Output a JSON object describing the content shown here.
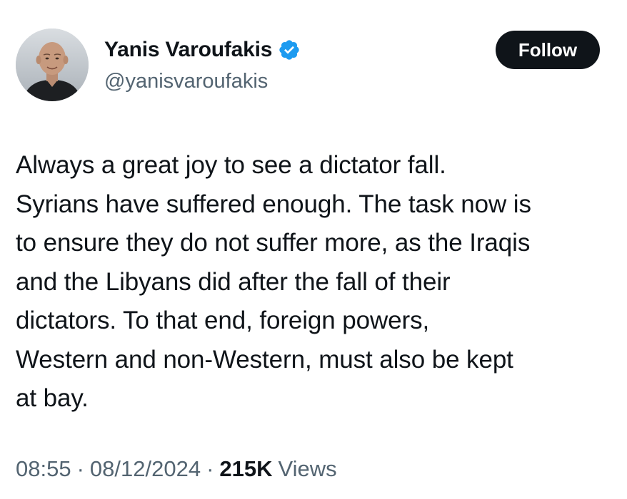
{
  "author": {
    "display_name": "Yanis Varoufakis",
    "handle": "@yanisvaroufakis",
    "verified_icon": "verified-badge-icon",
    "verified_color": "#1d9bf0",
    "avatar_icon": "profile-photo"
  },
  "actions": {
    "follow_label": "Follow"
  },
  "tweet": {
    "text": "Always a great joy to see a dictator fall.\nSyrians have suffered enough. The task now is\nto ensure they do not suffer more, as the Iraqis\nand the Libyans did after the fall of their\ndictators. To that end, foreign powers,\nWestern and non-Western, must also be kept\nat bay."
  },
  "meta": {
    "time": "08:55",
    "separator": "·",
    "date": "08/12/2024",
    "views_count": "215K",
    "views_label": "Views"
  },
  "colors": {
    "text_primary": "#0f1419",
    "text_secondary": "#536471",
    "button_bg": "#0f1419"
  }
}
